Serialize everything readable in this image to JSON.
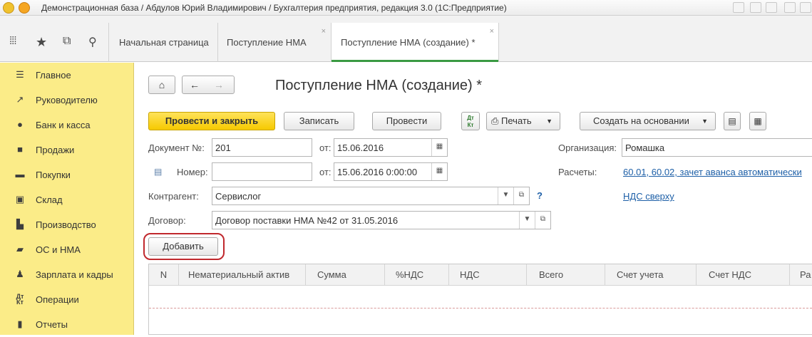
{
  "window": {
    "title": "Демонстрационная база / Абдулов Юрий Владимирович / Бухгалтерия предприятия, редакция 3.0  (1С:Предприятие)"
  },
  "tabs": [
    {
      "label": "Начальная страница"
    },
    {
      "label": "Поступление НМА"
    },
    {
      "label": "Поступление НМА (создание) *"
    }
  ],
  "sidebar": {
    "items": [
      {
        "label": "Главное",
        "icon": "menu-icon"
      },
      {
        "label": "Руководителю",
        "icon": "trend-icon"
      },
      {
        "label": "Банк и касса",
        "icon": "coin-icon"
      },
      {
        "label": "Продажи",
        "icon": "bag-icon"
      },
      {
        "label": "Покупки",
        "icon": "cart-icon"
      },
      {
        "label": "Склад",
        "icon": "box-icon"
      },
      {
        "label": "Производство",
        "icon": "factory-icon"
      },
      {
        "label": "ОС и НМА",
        "icon": "truck-icon"
      },
      {
        "label": "Зарплата и кадры",
        "icon": "people-icon"
      },
      {
        "label": "Операции",
        "icon": "dt-kt-icon"
      },
      {
        "label": "Отчеты",
        "icon": "chart-icon"
      }
    ]
  },
  "form": {
    "title": "Поступление НМА (создание) *",
    "toolbar": {
      "post_close": "Провести и закрыть",
      "save": "Записать",
      "post": "Провести",
      "dtkt": "Дт\nКт",
      "print": "Печать",
      "create_based": "Создать на основании"
    },
    "fields": {
      "doc_no_label": "Документ №:",
      "doc_no": "201",
      "from_label": "от:",
      "doc_date": "15.06.2016",
      "number_label": "Номер:",
      "number": "",
      "from2_label": "от:",
      "number_date": "15.06.2016  0:00:00",
      "contractor_label": "Контрагент:",
      "contractor": "Сервислог",
      "contract_label": "Договор:",
      "contract": "Договор поставки НМА №42 от 31.05.2016",
      "org_label": "Организация:",
      "org": "Ромашка",
      "settlements_label": "Расчеты:",
      "settlements": "60.01, 60.02, зачет аванса автоматически",
      "vat_link": "НДС сверху",
      "help": "?"
    },
    "add_button": "Добавить",
    "table_headers": [
      "N",
      "Нематериальный актив",
      "Сумма",
      "%НДС",
      "НДС",
      "Всего",
      "Счет учета",
      "Счет НДС",
      "Ра"
    ]
  },
  "colors": {
    "sidebar_bg": "#fbec88",
    "primary_button": "#f6c900",
    "active_tab_accent": "#3a9a43",
    "link": "#1d5fa7",
    "highlight_circle": "#c0282d"
  }
}
